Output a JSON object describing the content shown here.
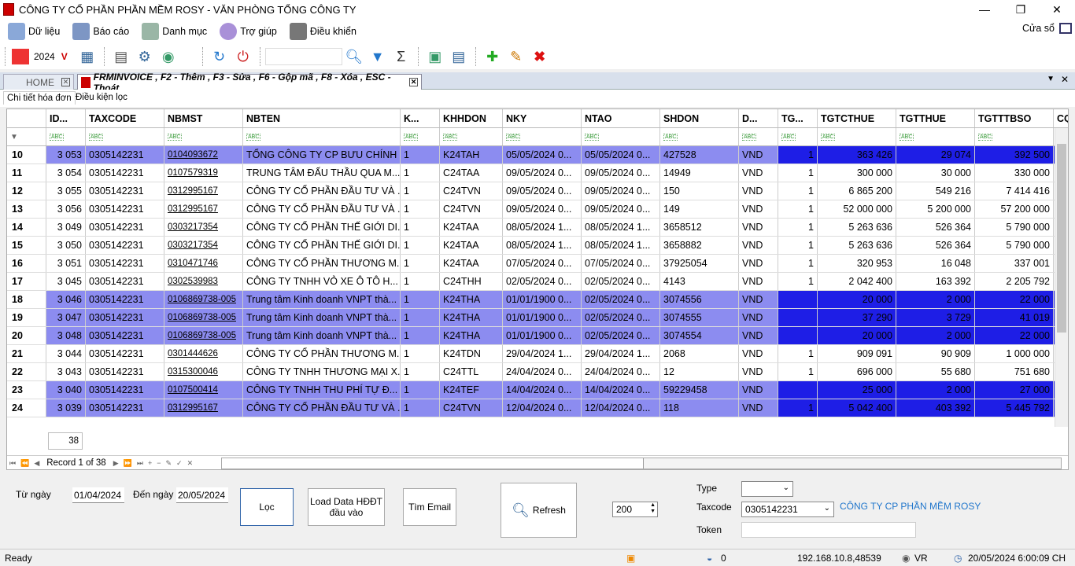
{
  "app": {
    "title": "CÔNG TY CỔ PHẦN PHẦN MỀM ROSY - VĂN PHÒNG TỔNG CÔNG TY"
  },
  "menu": {
    "items": [
      {
        "label": "Dữ liệu",
        "icon": "database-icon"
      },
      {
        "label": "Báo cáo",
        "icon": "report-icon"
      },
      {
        "label": "Danh mục",
        "icon": "catalog-icon"
      },
      {
        "label": "Trợ giúp",
        "icon": "help-icon"
      },
      {
        "label": "Điều khiển",
        "icon": "tools-icon"
      }
    ],
    "exit_label": "Cửa sổ"
  },
  "toolbar": {
    "year": "2024",
    "year_marker": "V"
  },
  "tabs": {
    "home": "HOME",
    "active": "FRMINVOICE , F2 - Thêm , F3 - Sửa , F6 - Gộp mã , F8 - Xóa , ESC - Thoát"
  },
  "subtabs": {
    "detail": "Chi tiết hóa đơn",
    "filter": "Điều kiện lọc"
  },
  "grid": {
    "columns": [
      "",
      "ID...",
      "TAXCODE",
      "NBMST",
      "NBTEN",
      "K...",
      "KHHDON",
      "NKY",
      "NTAO",
      "SHDON",
      "D...",
      "TG...",
      "TGTCTHUE",
      "TGTTHUE",
      "TGTTTBSO",
      "CQ"
    ],
    "rows": [
      {
        "n": "10",
        "id": "3 053",
        "tax": "0305142231",
        "nbmst": "0104093672",
        "nbten": "TỔNG CÔNG TY CP BƯU CHÍNH ...",
        "k": "1",
        "khhdon": "K24TAH",
        "nky": "05/05/2024 0...",
        "ntao": "05/05/2024 0...",
        "shdon": "427528",
        "d": "VND",
        "tg": "1",
        "tgtc": "363 426",
        "tgtt": "29 074",
        "tgtb": "392 500",
        "hl": "blue"
      },
      {
        "n": "11",
        "id": "3 054",
        "tax": "0305142231",
        "nbmst": "0107579319",
        "nbten": "TRUNG TÂM ĐẤU THẦU QUA M...",
        "k": "1",
        "khhdon": "C24TAA",
        "nky": "09/05/2024 0...",
        "ntao": "09/05/2024 0...",
        "shdon": "14949",
        "d": "VND",
        "tg": "1",
        "tgtc": "300 000",
        "tgtt": "30 000",
        "tgtb": "330 000",
        "hl": ""
      },
      {
        "n": "12",
        "id": "3 055",
        "tax": "0305142231",
        "nbmst": "0312995167",
        "nbten": "CÔNG TY CỔ PHẦN ĐẦU TƯ VÀ ...",
        "k": "1",
        "khhdon": "C24TVN",
        "nky": "09/05/2024 0...",
        "ntao": "09/05/2024 0...",
        "shdon": "150",
        "d": "VND",
        "tg": "1",
        "tgtc": "6 865 200",
        "tgtt": "549 216",
        "tgtb": "7 414 416",
        "hl": ""
      },
      {
        "n": "13",
        "id": "3 056",
        "tax": "0305142231",
        "nbmst": "0312995167",
        "nbten": "CÔNG TY CỔ PHẦN ĐẦU TƯ VÀ ...",
        "k": "1",
        "khhdon": "C24TVN",
        "nky": "09/05/2024 0...",
        "ntao": "09/05/2024 0...",
        "shdon": "149",
        "d": "VND",
        "tg": "1",
        "tgtc": "52 000 000",
        "tgtt": "5 200 000",
        "tgtb": "57 200 000",
        "hl": ""
      },
      {
        "n": "14",
        "id": "3 049",
        "tax": "0305142231",
        "nbmst": "0303217354",
        "nbten": "CÔNG TY CỔ PHẦN THẾ GIỚI DI...",
        "k": "1",
        "khhdon": "K24TAA",
        "nky": "08/05/2024 1...",
        "ntao": "08/05/2024 1...",
        "shdon": "3658512",
        "d": "VND",
        "tg": "1",
        "tgtc": "5 263 636",
        "tgtt": "526 364",
        "tgtb": "5 790 000",
        "hl": ""
      },
      {
        "n": "15",
        "id": "3 050",
        "tax": "0305142231",
        "nbmst": "0303217354",
        "nbten": "CÔNG TY CỔ PHẦN THẾ GIỚI DI...",
        "k": "1",
        "khhdon": "K24TAA",
        "nky": "08/05/2024 1...",
        "ntao": "08/05/2024 1...",
        "shdon": "3658882",
        "d": "VND",
        "tg": "1",
        "tgtc": "5 263 636",
        "tgtt": "526 364",
        "tgtb": "5 790 000",
        "hl": ""
      },
      {
        "n": "16",
        "id": "3 051",
        "tax": "0305142231",
        "nbmst": "0310471746",
        "nbten": "CÔNG TY CỔ PHẦN THƯƠNG M...",
        "k": "1",
        "khhdon": "K24TAA",
        "nky": "07/05/2024 0...",
        "ntao": "07/05/2024 0...",
        "shdon": "37925054",
        "d": "VND",
        "tg": "1",
        "tgtc": "320 953",
        "tgtt": "16 048",
        "tgtb": "337 001",
        "hl": ""
      },
      {
        "n": "17",
        "id": "3 045",
        "tax": "0305142231",
        "nbmst": "0302539983",
        "nbten": "CÔNG TY TNHH VỎ XE Ô TÔ H...",
        "k": "1",
        "khhdon": "C24THH",
        "nky": "02/05/2024 0...",
        "ntao": "02/05/2024 0...",
        "shdon": "4143",
        "d": "VND",
        "tg": "1",
        "tgtc": "2 042 400",
        "tgtt": "163 392",
        "tgtb": "2 205 792",
        "hl": ""
      },
      {
        "n": "18",
        "id": "3 046",
        "tax": "0305142231",
        "nbmst": "0106869738-005",
        "nbten": "Trung tâm Kinh doanh VNPT thà...",
        "k": "1",
        "khhdon": "K24THA",
        "nky": "01/01/1900 0...",
        "ntao": "02/05/2024 0...",
        "shdon": "3074556",
        "d": "VND",
        "tg": "",
        "tgtc": "20 000",
        "tgtt": "2 000",
        "tgtb": "22 000",
        "hl": "blue"
      },
      {
        "n": "19",
        "id": "3 047",
        "tax": "0305142231",
        "nbmst": "0106869738-005",
        "nbten": "Trung tâm Kinh doanh VNPT thà...",
        "k": "1",
        "khhdon": "K24THA",
        "nky": "01/01/1900 0...",
        "ntao": "02/05/2024 0...",
        "shdon": "3074555",
        "d": "VND",
        "tg": "",
        "tgtc": "37 290",
        "tgtt": "3 729",
        "tgtb": "41 019",
        "hl": "blue"
      },
      {
        "n": "20",
        "id": "3 048",
        "tax": "0305142231",
        "nbmst": "0106869738-005",
        "nbten": "Trung tâm Kinh doanh VNPT thà...",
        "k": "1",
        "khhdon": "K24THA",
        "nky": "01/01/1900 0...",
        "ntao": "02/05/2024 0...",
        "shdon": "3074554",
        "d": "VND",
        "tg": "",
        "tgtc": "20 000",
        "tgtt": "2 000",
        "tgtb": "22 000",
        "hl": "blue"
      },
      {
        "n": "21",
        "id": "3 044",
        "tax": "0305142231",
        "nbmst": "0301444626",
        "nbten": "CÔNG TY CỔ PHẦN THƯƠNG M...",
        "k": "1",
        "khhdon": "K24TDN",
        "nky": "29/04/2024 1...",
        "ntao": "29/04/2024 1...",
        "shdon": "2068",
        "d": "VND",
        "tg": "1",
        "tgtc": "909 091",
        "tgtt": "90 909",
        "tgtb": "1 000 000",
        "hl": ""
      },
      {
        "n": "22",
        "id": "3 043",
        "tax": "0305142231",
        "nbmst": "0315300046",
        "nbten": "CÔNG TY TNHH THƯƠNG MẠI X...",
        "k": "1",
        "khhdon": "C24TTL",
        "nky": "24/04/2024 0...",
        "ntao": "24/04/2024 0...",
        "shdon": "12",
        "d": "VND",
        "tg": "1",
        "tgtc": "696 000",
        "tgtt": "55 680",
        "tgtb": "751 680",
        "hl": ""
      },
      {
        "n": "23",
        "id": "3 040",
        "tax": "0305142231",
        "nbmst": "0107500414",
        "nbten": "CÔNG TY TNHH THU PHÍ TỰ Đ...",
        "k": "1",
        "khhdon": "K24TEF",
        "nky": "14/04/2024 0...",
        "ntao": "14/04/2024 0...",
        "shdon": "59229458",
        "d": "VND",
        "tg": "",
        "tgtc": "25 000",
        "tgtt": "2 000",
        "tgtb": "27 000",
        "hl": "blue"
      },
      {
        "n": "24",
        "id": "3 039",
        "tax": "0305142231",
        "nbmst": "0312995167",
        "nbten": "CÔNG TY CỔ PHẦN ĐẦU TƯ VÀ ...",
        "k": "1",
        "khhdon": "C24TVN",
        "nky": "12/04/2024 0...",
        "ntao": "12/04/2024 0...",
        "shdon": "118",
        "d": "VND",
        "tg": "1",
        "tgtc": "5 042 400",
        "tgtt": "403 392",
        "tgtb": "5 445 792",
        "hl": "blue"
      }
    ],
    "count": "38",
    "record_label": "Record 1 of 38"
  },
  "filter": {
    "from_label": "Từ ngày",
    "from_value": "01/04/2024",
    "to_label": "Đến ngày",
    "to_value": "20/05/2024",
    "loc_button": "Lọc",
    "load_button_line1": "Load Data HĐĐT",
    "load_button_line2": "đầu vào",
    "email_button": "Tìm Email",
    "refresh_button": "Refresh",
    "spin_value": "200",
    "type_label": "Type",
    "taxcode_label": "Taxcode",
    "taxcode_value": "0305142231",
    "company_name": "CÔNG TY CP PHẦN MỀM ROSY",
    "token_label": "Token"
  },
  "status": {
    "ready": "Ready",
    "count": "0",
    "ip": "192.168.10.8,48539",
    "lang": "VR",
    "datetime": "20/05/2024 6:00:09 CH"
  },
  "colors": {
    "highlight": "#1e1ee6",
    "highlight_light": "#8c8cf0"
  }
}
